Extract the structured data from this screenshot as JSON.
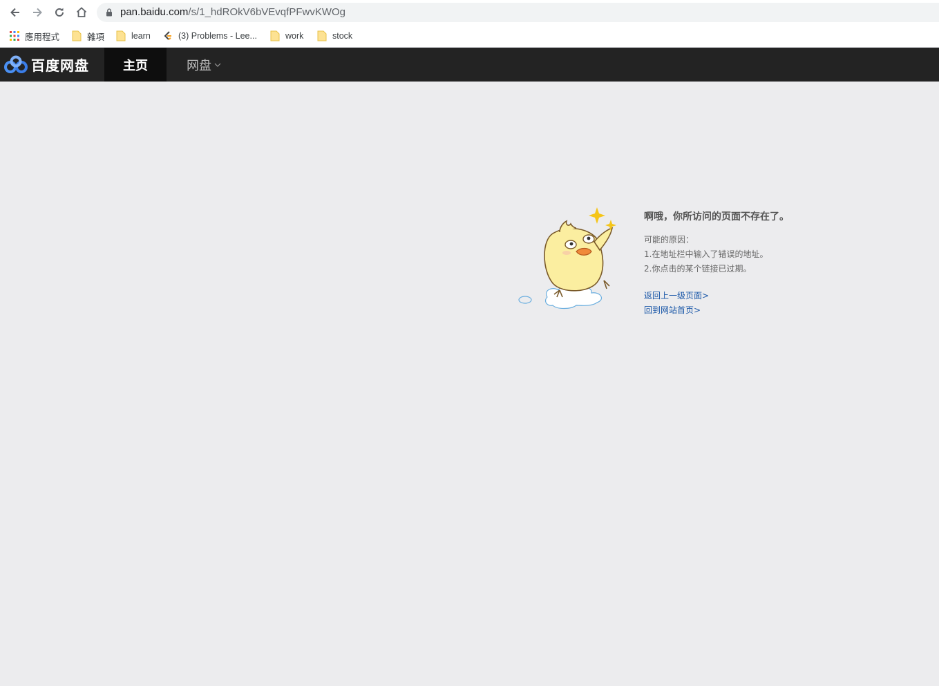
{
  "browser": {
    "url_host": "pan.baidu.com",
    "url_path": "/s/1_hdROkV6bVEvqfPFwvKWOg",
    "bookmarks": [
      {
        "label": "應用程式",
        "icon": "apps-grid-icon"
      },
      {
        "label": "雜項",
        "icon": "folder-icon"
      },
      {
        "label": "learn",
        "icon": "folder-icon"
      },
      {
        "label": "(3) Problems - Lee...",
        "icon": "leetcode-icon"
      },
      {
        "label": "work",
        "icon": "folder-icon"
      },
      {
        "label": "stock",
        "icon": "folder-icon"
      }
    ]
  },
  "header": {
    "logo_text": "百度网盘",
    "tabs": [
      {
        "label": "主页",
        "active": true
      },
      {
        "label": "网盘",
        "active": false
      }
    ]
  },
  "error": {
    "title": "啊哦，你所访问的页面不存在了。",
    "reasons_heading": "可能的原因：",
    "reasons": [
      "1.在地址栏中输入了错误的地址。",
      "2.你点击的某个链接已过期。"
    ],
    "links": [
      "返回上一级页面>",
      "回到网站首页>"
    ]
  },
  "colors": {
    "header_bg": "#232323",
    "active_tab_bg": "#0e0e0e",
    "page_bg": "#ececee",
    "link": "#1a57a8"
  }
}
